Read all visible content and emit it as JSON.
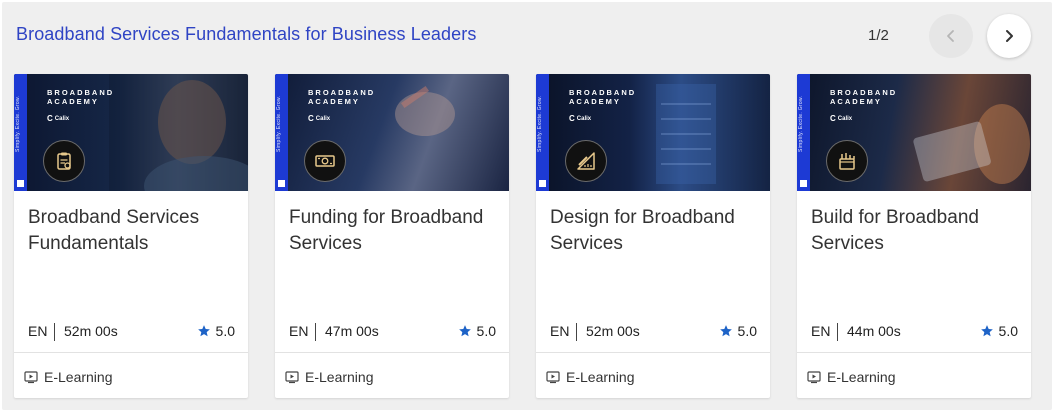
{
  "section": {
    "title": "Broadband Services Fundamentals for Business Leaders",
    "pager": "1/2"
  },
  "nav": {
    "prev_icon": "chevron-left-icon",
    "next_icon": "chevron-right-icon"
  },
  "thumbnail": {
    "academy_line1": "BROADBAND",
    "academy_line2": "ACADEMY",
    "brand": "Calix",
    "side_text": "Simplify. Excite. Grow."
  },
  "cards": [
    {
      "title": "Broadband Services Fundamentals",
      "language": "EN",
      "duration": "52m 00s",
      "rating": "5.0",
      "type": "E-Learning",
      "badge_icon": "clipboard-icon"
    },
    {
      "title": "Funding for Broadband Services",
      "language": "EN",
      "duration": "47m 00s",
      "rating": "5.0",
      "type": "E-Learning",
      "badge_icon": "money-icon"
    },
    {
      "title": "Design for Broadband Services",
      "language": "EN",
      "duration": "52m 00s",
      "rating": "5.0",
      "type": "E-Learning",
      "badge_icon": "design-ruler-icon"
    },
    {
      "title": "Build for Broadband Services",
      "language": "EN",
      "duration": "44m 00s",
      "rating": "5.0",
      "type": "E-Learning",
      "badge_icon": "build-tools-icon"
    }
  ],
  "colors": {
    "title_blue": "#2f44c4",
    "star_blue": "#1e63c7",
    "strip_blue": "#1d3ad4",
    "panel_bg": "#efefef"
  }
}
